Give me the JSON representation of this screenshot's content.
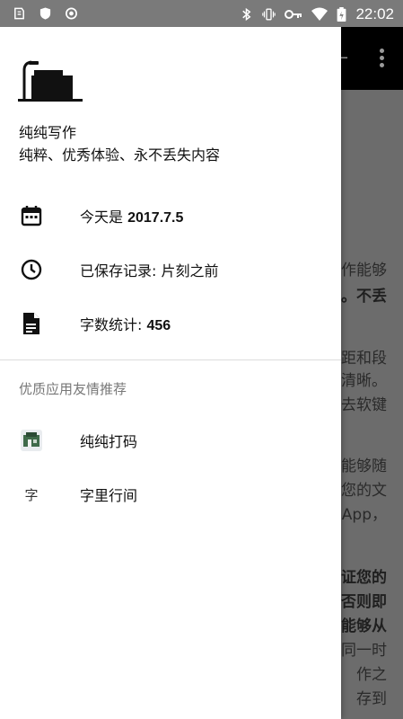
{
  "status_bar": {
    "time": "22:02",
    "left_icons": [
      "app-icon",
      "shield-icon",
      "record-icon"
    ],
    "right_icons": [
      "bluetooth-icon",
      "vibrate-icon",
      "key-icon",
      "wifi-icon",
      "battery-charging-icon"
    ]
  },
  "background": {
    "lines": [
      {
        "text": "作能够",
        "bold": false
      },
      {
        "text": "。不丢",
        "bold": true
      },
      {
        "text": "距和段",
        "bold": false
      },
      {
        "text": "清晰。",
        "bold": false
      },
      {
        "text": "去软键",
        "bold": false
      },
      {
        "text": "能够随",
        "bold": false
      },
      {
        "text": "您的文",
        "bold": false
      },
      {
        "text": "App，",
        "bold": false
      },
      {
        "text": "证您的",
        "bold": true
      },
      {
        "text": "否则即",
        "bold": true
      },
      {
        "text": "能够从",
        "bold": true
      },
      {
        "text": "同一时",
        "bold": false
      },
      {
        "text": "作之",
        "bold": false
      },
      {
        "text": "存到",
        "bold": false
      }
    ]
  },
  "drawer": {
    "title": "纯纯写作",
    "subtitle": "纯粹、优秀体验、永不丢失内容",
    "items": [
      {
        "icon": "calendar-icon",
        "prefix": "今天是 ",
        "value": "2017.7.5"
      },
      {
        "icon": "clock-icon",
        "prefix": "已保存记录: 片刻之前",
        "value": ""
      },
      {
        "icon": "document-icon",
        "prefix": "字数统计: ",
        "value": "456"
      }
    ],
    "section_title": "优质应用友情推荐",
    "recommended": [
      {
        "icon": "chunchun-daima-app-icon",
        "label": "纯纯打码"
      },
      {
        "icon": "zi-li-hang-jian-app-icon",
        "label": "字里行间",
        "glyph": "字"
      }
    ]
  },
  "colors": {
    "drawer_bg": "#ffffff",
    "toolbar_bg": "#000000",
    "scrim": "#6c6c6c",
    "section_text": "#777777"
  }
}
